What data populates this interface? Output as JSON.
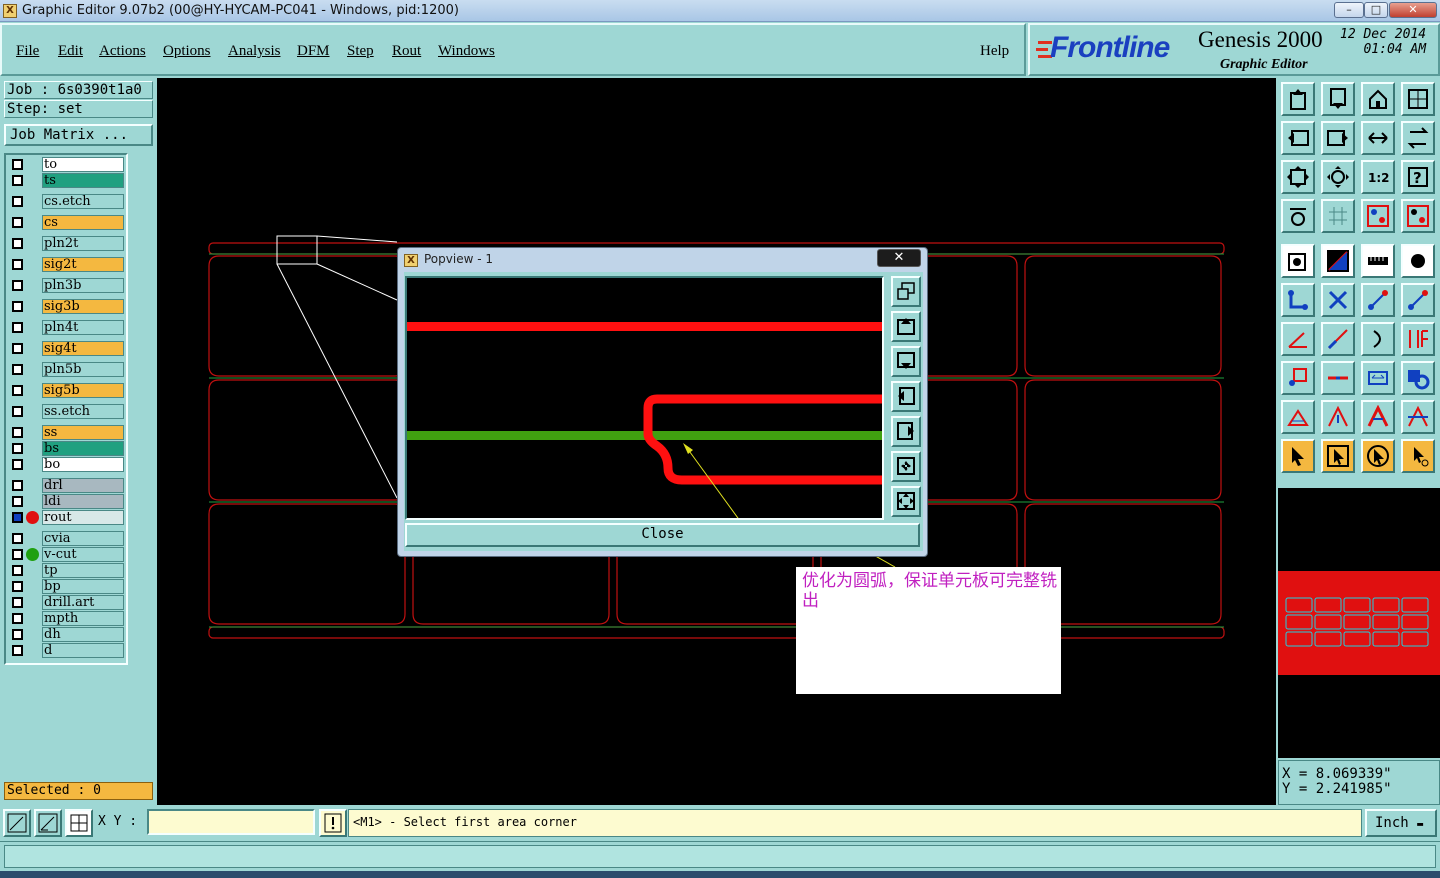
{
  "window": {
    "title": "Graphic Editor 9.07b2 (00@HY-HYCAM-PC041 - Windows, pid:1200)",
    "minimize": "–",
    "maximize": "□",
    "close": "✕"
  },
  "menu": {
    "items": [
      "File",
      "Edit",
      "Actions",
      "Options",
      "Analysis",
      "DFM",
      "Step",
      "Rout",
      "Windows"
    ],
    "help": "Help"
  },
  "brand": {
    "logo": "Frontline",
    "app": "Genesis 2000",
    "subtitle": "Graphic Editor",
    "date": "12 Dec 2014",
    "time": "01:04 AM"
  },
  "job": {
    "job_label": "Job : 6s0390t1a0",
    "step_label": "Step: set",
    "matrix_button": "Job Matrix ..."
  },
  "layers": [
    {
      "name": "to",
      "color": "#ffffff"
    },
    {
      "name": "ts",
      "color": "#20a080"
    },
    {
      "name": "cs.etch",
      "color": "#9ed7d4"
    },
    {
      "name": "cs",
      "color": "#f4b840"
    },
    {
      "name": "pln2t",
      "color": "#9ed7d4"
    },
    {
      "name": "sig2t",
      "color": "#f4b840"
    },
    {
      "name": "pln3b",
      "color": "#9ed7d4"
    },
    {
      "name": "sig3b",
      "color": "#f4b840"
    },
    {
      "name": "pln4t",
      "color": "#9ed7d4"
    },
    {
      "name": "sig4t",
      "color": "#f4b840"
    },
    {
      "name": "pln5b",
      "color": "#9ed7d4"
    },
    {
      "name": "sig5b",
      "color": "#f4b840"
    },
    {
      "name": "ss.etch",
      "color": "#9ed7d4"
    },
    {
      "name": "ss",
      "color": "#f4b840"
    },
    {
      "name": "bs",
      "color": "#20a080"
    },
    {
      "name": "bo",
      "color": "#ffffff"
    },
    {
      "name": "drl",
      "color": "#a8b8c0"
    },
    {
      "name": "ldi",
      "color": "#a8b8c0"
    },
    {
      "name": "rout",
      "color": "#d8e8e8"
    },
    {
      "name": "cvia",
      "color": "#9ed7d4"
    },
    {
      "name": "v-cut",
      "color": "#9ed7d4"
    },
    {
      "name": "tp",
      "color": "#9ed7d4"
    },
    {
      "name": "bp",
      "color": "#9ed7d4"
    },
    {
      "name": "drill.art",
      "color": "#9ed7d4"
    },
    {
      "name": "mpth",
      "color": "#9ed7d4"
    },
    {
      "name": "dh",
      "color": "#9ed7d4"
    },
    {
      "name": "d",
      "color": "#9ed7d4"
    }
  ],
  "selected": "Selected : 0",
  "coords": {
    "x": "X = 8.069339\"",
    "y": "Y = 2.241985\""
  },
  "status": {
    "xy_label": "X Y :",
    "xy_value": "",
    "message": "<M1> - Select first area corner",
    "units": "Inch"
  },
  "popview": {
    "title": "Popview - 1",
    "close_label": "Close"
  },
  "annotation": "优化为圆弧，保证单元板可完整铣出"
}
